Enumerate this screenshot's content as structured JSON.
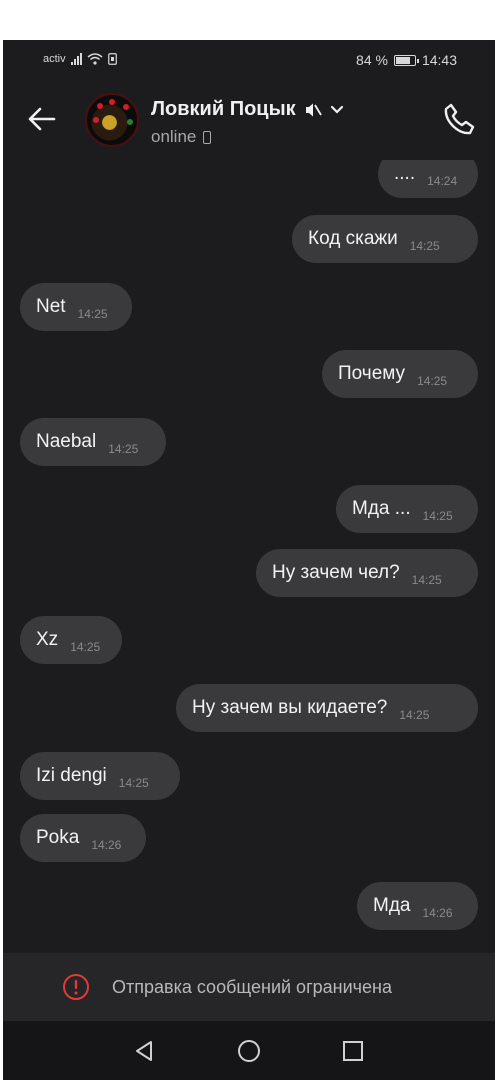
{
  "status_bar": {
    "carrier": "activ",
    "battery_percent": "84 %",
    "battery_level": 0.84,
    "time": "14:43"
  },
  "header": {
    "contact_name": "Ловкий Поцык",
    "status": "online",
    "icons": [
      "back-arrow-icon",
      "muted-speaker-icon",
      "chevron-down-icon",
      "phone-call-icon",
      "mobile-device-icon"
    ]
  },
  "messages": [
    {
      "side": "out",
      "text": "....",
      "time": "14:24"
    },
    {
      "side": "out",
      "text": "Код скажи",
      "time": "14:25"
    },
    {
      "side": "in",
      "text": "Net",
      "time": "14:25"
    },
    {
      "side": "out",
      "text": "Почему",
      "time": "14:25"
    },
    {
      "side": "in",
      "text": "Naebal",
      "time": "14:25"
    },
    {
      "side": "out",
      "text": "Мда ...",
      "time": "14:25"
    },
    {
      "side": "out",
      "text": "Ну зачем чел?",
      "time": "14:25"
    },
    {
      "side": "in",
      "text": "Xz",
      "time": "14:25"
    },
    {
      "side": "out",
      "text": "Ну зачем вы кидаете?",
      "time": "14:25"
    },
    {
      "side": "in",
      "text": "Izi dengi",
      "time": "14:25"
    },
    {
      "side": "in",
      "text": "Poka",
      "time": "14:26"
    },
    {
      "side": "out",
      "text": "Мда",
      "time": "14:26"
    }
  ],
  "restriction": {
    "text": "Отправка сообщений ограничена",
    "icon": "warning-circle-icon",
    "accent_color": "#e53935"
  },
  "nav_bar": {
    "icons": [
      "back-triangle-icon",
      "home-circle-icon",
      "recents-square-icon"
    ]
  },
  "colors": {
    "background": "#1c1c1e",
    "bubble": "#3a3a3c"
  }
}
